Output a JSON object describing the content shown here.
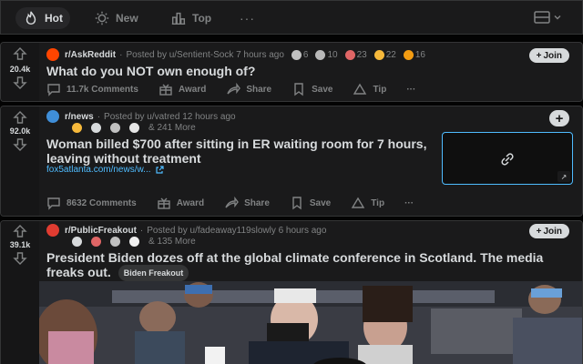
{
  "sortbar": {
    "tabs": [
      {
        "label": "Hot",
        "icon": "flame-icon",
        "active": true
      },
      {
        "label": "New",
        "icon": "sun-icon",
        "active": false
      },
      {
        "label": "Top",
        "icon": "bar-chart-icon",
        "active": false
      }
    ],
    "more": "···",
    "layout_icon": "card-layout-icon"
  },
  "posts": [
    {
      "score": "20.4k",
      "subreddit": "r/AskReddit",
      "posted_by": "Posted by u/Sentient-Sock 7 hours ago",
      "awards": [
        "6",
        "10",
        "23",
        "22",
        "16"
      ],
      "title": "What do you NOT own enough of?",
      "join": "Join",
      "actions": {
        "comments": "11.7k Comments",
        "award": "Award",
        "share": "Share",
        "save": "Save",
        "tip": "Tip",
        "more": "···"
      }
    },
    {
      "score": "92.0k",
      "subreddit": "r/news",
      "posted_by": "Posted by u/vatred 12 hours ago",
      "awards_more": "& 241 More",
      "title": "Woman billed $700 after sitting in ER waiting room for 7 hours, leaving without treatment",
      "link": "fox5atlanta.com/news/w...",
      "join": "+",
      "actions": {
        "comments": "8632 Comments",
        "award": "Award",
        "share": "Share",
        "save": "Save",
        "tip": "Tip",
        "more": "···"
      }
    },
    {
      "score": "39.1k",
      "subreddit": "r/PublicFreakout",
      "posted_by": "Posted by u/fadeaway119slowly 6 hours ago",
      "awards_more": "& 135 More",
      "title": "President Biden dozes off at the global climate conference in Scotland. The media freaks out.",
      "flair": "Biden Freakout",
      "join": "Join"
    }
  ],
  "colors": {
    "bg": "#030303",
    "card": "#1a1a1b",
    "border": "#343536",
    "text": "#d7dadc",
    "muted": "#818384",
    "link": "#4fbcff"
  }
}
